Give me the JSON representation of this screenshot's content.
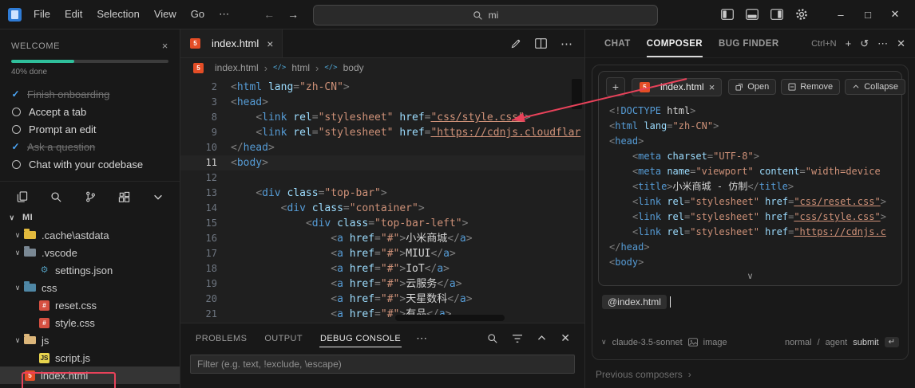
{
  "colors": {
    "annotation_red": "#e8425a",
    "progress_teal": "#2fbf9b",
    "html_icon_orange": "#e44d26"
  },
  "icons": {
    "more": "⋯",
    "close": "✕",
    "tab_close": "×",
    "chevron_down": "∨",
    "chevron_right": "›",
    "back_arrow": "←",
    "forward_arrow": "→",
    "minimize": "–",
    "maximize": "□",
    "plus": "+",
    "history": "↺",
    "enter_key": "↵",
    "html_badge": "5"
  },
  "title_bar": {
    "menus": [
      "File",
      "Edit",
      "Selection",
      "View",
      "Go"
    ],
    "search_value": "mi"
  },
  "welcome": {
    "header": "WELCOME",
    "progress_pct": 40,
    "progress_label": "40% done",
    "items": [
      {
        "label": "Finish onboarding",
        "done": true
      },
      {
        "label": "Accept a tab",
        "done": false
      },
      {
        "label": "Prompt an edit",
        "done": false
      },
      {
        "label": "Ask a question",
        "done": true
      },
      {
        "label": "Chat with your codebase",
        "done": false
      }
    ]
  },
  "explorer": {
    "root_label": "MI",
    "items": [
      {
        "label": ".cache\\astdata",
        "kind": "folder",
        "depth": 1,
        "color": "#e2b93d"
      },
      {
        "label": ".vscode",
        "kind": "folder",
        "depth": 1,
        "color": "#7a8894"
      },
      {
        "label": "settings.json",
        "kind": "file",
        "depth": 2,
        "glyph": "⚙",
        "color": "#519aba"
      },
      {
        "label": "css",
        "kind": "folder",
        "depth": 1,
        "color": "#4f87a5"
      },
      {
        "label": "reset.css",
        "kind": "file",
        "depth": 2,
        "badge": "#",
        "color": "#d65041"
      },
      {
        "label": "style.css",
        "kind": "file",
        "depth": 2,
        "badge": "#",
        "color": "#d65041"
      },
      {
        "label": "js",
        "kind": "folder",
        "depth": 1,
        "color": "#dcb67a"
      },
      {
        "label": "script.js",
        "kind": "file",
        "depth": 2,
        "badge": "JS",
        "color": "#e8d44d",
        "dark_text": true
      },
      {
        "label": "index.html",
        "kind": "file",
        "depth": 1,
        "badge": "5",
        "color": "#e44d26",
        "selected": true
      }
    ]
  },
  "editor": {
    "tab": {
      "label": "index.html"
    },
    "breadcrumb": [
      "index.html",
      "html",
      "body"
    ],
    "lines": [
      {
        "n": 2,
        "code": "<html lang=\"zh-CN\">"
      },
      {
        "n": 3,
        "code": "<head>"
      },
      {
        "n": 8,
        "code": "    <link rel=\"stylesheet\" href=\"css/style.css\">"
      },
      {
        "n": 9,
        "code": "    <link rel=\"stylesheet\" href=\"https://cdnjs.cloudflar"
      },
      {
        "n": 10,
        "code": "</head>"
      },
      {
        "n": 11,
        "code": "<body>",
        "current": true
      },
      {
        "n": 12,
        "code": ""
      },
      {
        "n": 13,
        "code": "    <div class=\"top-bar\">"
      },
      {
        "n": 14,
        "code": "        <div class=\"container\">"
      },
      {
        "n": 15,
        "code": "            <div class=\"top-bar-left\">"
      },
      {
        "n": 16,
        "code": "                <a href=\"#\">小米商城</a>"
      },
      {
        "n": 17,
        "code": "                <a href=\"#\">MIUI</a>"
      },
      {
        "n": 18,
        "code": "                <a href=\"#\">IoT</a>"
      },
      {
        "n": 19,
        "code": "                <a href=\"#\">云服务</a>"
      },
      {
        "n": 20,
        "code": "                <a href=\"#\">天星数科</a>"
      },
      {
        "n": 21,
        "code": "                <a href=\"#\">有品</a>"
      }
    ]
  },
  "bottom_panel": {
    "tabs": [
      {
        "label": "PROBLEMS",
        "active": false
      },
      {
        "label": "OUTPUT",
        "active": false
      },
      {
        "label": "DEBUG CONSOLE",
        "active": true
      }
    ],
    "filter_placeholder": "Filter (e.g. text, !exclude, \\escape)"
  },
  "composer": {
    "tabs": [
      {
        "label": "CHAT",
        "active": false
      },
      {
        "label": "COMPOSER",
        "active": true
      },
      {
        "label": "BUG FINDER",
        "active": false
      }
    ],
    "shortcut": "Ctrl+N",
    "context_file": {
      "label": "index.html"
    },
    "buttons": [
      {
        "label": "Open"
      },
      {
        "label": "Remove"
      },
      {
        "label": "Collapse"
      }
    ],
    "code_lines": [
      "<!DOCTYPE html>",
      "<html lang=\"zh-CN\">",
      "<head>",
      "    <meta charset=\"UTF-8\">",
      "    <meta name=\"viewport\" content=\"width=device",
      "    <title>小米商城 - 仿制</title>",
      "    <link rel=\"stylesheet\" href=\"css/reset.css\">",
      "    <link rel=\"stylesheet\" href=\"css/style.css\">",
      "    <link rel=\"stylesheet\" href=\"https://cdnjs.c",
      "</head>",
      "<body>"
    ],
    "input_chip": "@index.html",
    "model": "claude-3.5-sonnet",
    "image_label": "image",
    "mode_normal": "normal",
    "mode_separator": "/",
    "mode_agent": "agent",
    "submit_label": "submit",
    "previous_label": "Previous composers"
  }
}
